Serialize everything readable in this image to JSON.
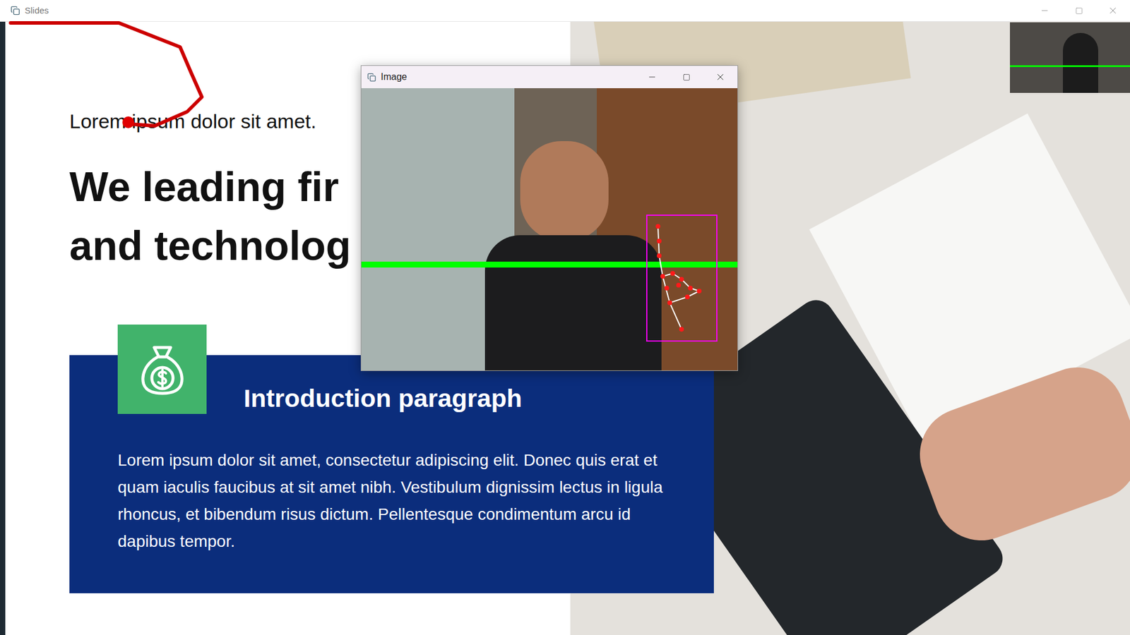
{
  "window": {
    "title": "Slides"
  },
  "slide": {
    "subtitle": "Lorem ipsum dolor sit amet.",
    "heading": [
      "We leading fir",
      "and technolog"
    ],
    "card": {
      "title": "Introduction paragraph",
      "body": "Lorem ipsum dolor sit amet, consectetur adipiscing elit. Donec quis erat et quam iaculis faucibus at sit amet nibh. Vestibulum dignissim lectus in ligula rhoncus, et bibendum risus dictum. Pellentesque condimentum arcu id dapibus tempor."
    }
  },
  "camera_window": {
    "title": "Image"
  }
}
